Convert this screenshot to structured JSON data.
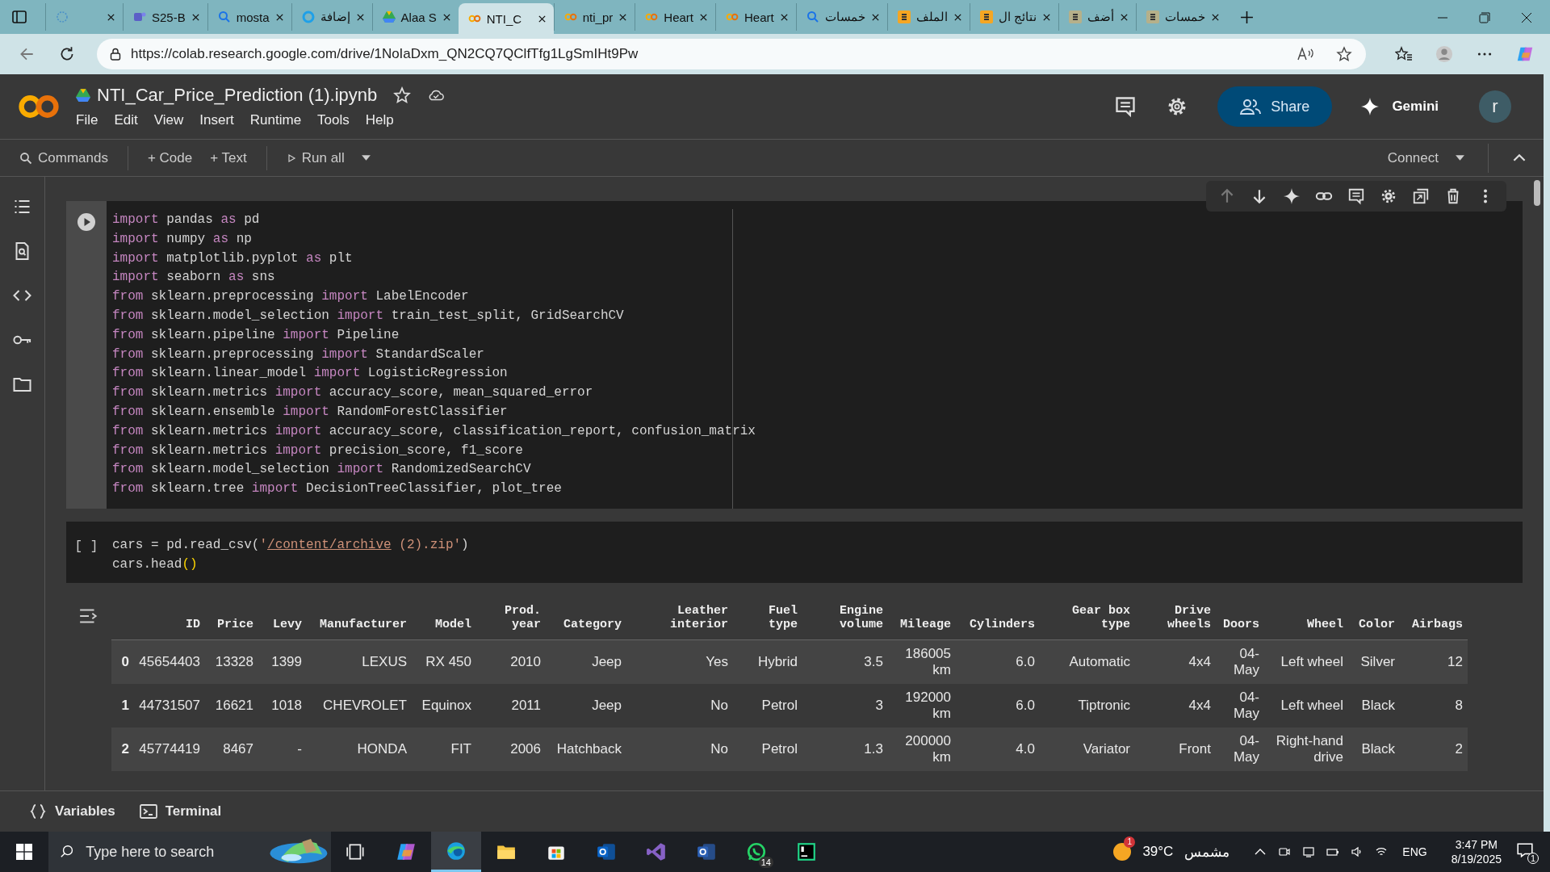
{
  "browser": {
    "tabs": [
      {
        "kind": "loading",
        "selected": false
      },
      {
        "label": "S25-B",
        "kind": "teams",
        "selected": false
      },
      {
        "label": "mosta",
        "kind": "search",
        "selected": false
      },
      {
        "label": "إضافة",
        "kind": "ring",
        "selected": false
      },
      {
        "label": "Alaa S",
        "kind": "drive",
        "selected": false
      },
      {
        "label": "NTI_C",
        "kind": "colab",
        "selected": true
      },
      {
        "label": "nti_pr",
        "kind": "colab",
        "selected": false
      },
      {
        "label": "Heart",
        "kind": "colab",
        "selected": false
      },
      {
        "label": "Heart",
        "kind": "colab",
        "selected": false
      },
      {
        "label": "خمسات",
        "kind": "search",
        "selected": false
      },
      {
        "label": "الملف",
        "kind": "five",
        "selected": false
      },
      {
        "label": "نتائج ال",
        "kind": "five",
        "selected": false
      },
      {
        "label": "أضف",
        "kind": "five-dim",
        "selected": false
      },
      {
        "label": "خمسات",
        "kind": "five-dim",
        "selected": false
      }
    ],
    "url": "https://colab.research.google.com/drive/1NoIaDxm_QN2CQ7QClfTfg1LgSmIHt9Pw"
  },
  "notebook": {
    "title": "NTI_Car_Price_Prediction (1).ipynb",
    "menu": [
      "File",
      "Edit",
      "View",
      "Insert",
      "Runtime",
      "Tools",
      "Help"
    ],
    "share": "Share",
    "gemini": "Gemini",
    "avatar": "r"
  },
  "toolbar": {
    "commands": "Commands",
    "add_code": "+ Code",
    "add_text": "+ Text",
    "run_all": "Run all",
    "connect": "Connect"
  },
  "cells": [
    {
      "kind": "run",
      "lines": [
        [
          {
            "kind": "keyword",
            "text": "import"
          },
          {
            "kind": "plain",
            "text": " pandas "
          },
          {
            "kind": "keyword",
            "text": "as"
          },
          {
            "kind": "plain",
            "text": " pd"
          }
        ],
        [
          {
            "kind": "keyword",
            "text": "import"
          },
          {
            "kind": "plain",
            "text": " numpy "
          },
          {
            "kind": "keyword",
            "text": "as"
          },
          {
            "kind": "plain",
            "text": " np"
          }
        ],
        [
          {
            "kind": "keyword",
            "text": "import"
          },
          {
            "kind": "plain",
            "text": " matplotlib.pyplot "
          },
          {
            "kind": "keyword",
            "text": "as"
          },
          {
            "kind": "plain",
            "text": " plt"
          }
        ],
        [
          {
            "kind": "keyword",
            "text": "import"
          },
          {
            "kind": "plain",
            "text": " seaborn "
          },
          {
            "kind": "keyword",
            "text": "as"
          },
          {
            "kind": "plain",
            "text": " sns"
          }
        ],
        [
          {
            "kind": "keyword",
            "text": "from"
          },
          {
            "kind": "plain",
            "text": " sklearn.preprocessing "
          },
          {
            "kind": "keyword",
            "text": "import"
          },
          {
            "kind": "plain",
            "text": " LabelEncoder"
          }
        ],
        [
          {
            "kind": "keyword",
            "text": "from"
          },
          {
            "kind": "plain",
            "text": " sklearn.model_selection "
          },
          {
            "kind": "keyword",
            "text": "import"
          },
          {
            "kind": "plain",
            "text": " train_test_split, GridSearchCV"
          }
        ],
        [
          {
            "kind": "keyword",
            "text": "from"
          },
          {
            "kind": "plain",
            "text": " sklearn.pipeline "
          },
          {
            "kind": "keyword",
            "text": "import"
          },
          {
            "kind": "plain",
            "text": " Pipeline"
          }
        ],
        [
          {
            "kind": "keyword",
            "text": "from"
          },
          {
            "kind": "plain",
            "text": " sklearn.preprocessing "
          },
          {
            "kind": "keyword",
            "text": "import"
          },
          {
            "kind": "plain",
            "text": " StandardScaler"
          }
        ],
        [
          {
            "kind": "keyword",
            "text": "from"
          },
          {
            "kind": "plain",
            "text": " sklearn.linear_model "
          },
          {
            "kind": "keyword",
            "text": "import"
          },
          {
            "kind": "plain",
            "text": " LogisticRegression"
          }
        ],
        [
          {
            "kind": "keyword",
            "text": "from"
          },
          {
            "kind": "plain",
            "text": " sklearn.metrics "
          },
          {
            "kind": "keyword",
            "text": "import"
          },
          {
            "kind": "plain",
            "text": " accuracy_score, mean_squared_error"
          }
        ],
        [
          {
            "kind": "keyword",
            "text": "from"
          },
          {
            "kind": "plain",
            "text": " sklearn.ensemble "
          },
          {
            "kind": "keyword",
            "text": "import"
          },
          {
            "kind": "plain",
            "text": " RandomForestClassifier"
          }
        ],
        [
          {
            "kind": "keyword",
            "text": "from"
          },
          {
            "kind": "plain",
            "text": " sklearn.metrics "
          },
          {
            "kind": "keyword",
            "text": "import"
          },
          {
            "kind": "plain",
            "text": " accuracy_score, classification_report, confusion_matrix"
          }
        ],
        [
          {
            "kind": "keyword",
            "text": "from"
          },
          {
            "kind": "plain",
            "text": " sklearn.metrics "
          },
          {
            "kind": "keyword",
            "text": "import"
          },
          {
            "kind": "plain",
            "text": " precision_score, f1_score"
          }
        ],
        [
          {
            "kind": "keyword",
            "text": "from"
          },
          {
            "kind": "plain",
            "text": " sklearn.model_selection "
          },
          {
            "kind": "keyword",
            "text": "import"
          },
          {
            "kind": "plain",
            "text": " RandomizedSearchCV"
          }
        ],
        [
          {
            "kind": "keyword",
            "text": "from"
          },
          {
            "kind": "plain",
            "text": " sklearn.tree "
          },
          {
            "kind": "keyword",
            "text": "import"
          },
          {
            "kind": "plain",
            "text": " DecisionTreeClassifier, plot_tree"
          }
        ]
      ]
    },
    {
      "kind": "idle",
      "prompt": "[ ]",
      "lines": [
        [
          {
            "kind": "plain",
            "text": "cars = pd.read_csv("
          },
          {
            "kind": "string",
            "text": "'"
          },
          {
            "kind": "link",
            "text": "/content/archive"
          },
          {
            "kind": "string",
            "text": " (2).zip'"
          },
          {
            "kind": "plain",
            "text": ")"
          }
        ],
        [
          {
            "kind": "plain",
            "text": "cars.head"
          },
          {
            "kind": "paren",
            "text": "()"
          }
        ]
      ]
    }
  ],
  "output": {
    "columns": [
      "ID",
      "Price",
      "Levy",
      "Manufacturer",
      "Model",
      "Prod. year",
      "Category",
      "Leather interior",
      "Fuel type",
      "Engine volume",
      "Mileage",
      "Cylinders",
      "Gear box type",
      "Drive wheels",
      "Doors",
      "Wheel",
      "Color",
      "Airbags"
    ],
    "rows": [
      {
        "index": "0",
        "cells": [
          "45654403",
          "13328",
          "1399",
          "LEXUS",
          "RX 450",
          "2010",
          "Jeep",
          "Yes",
          "Hybrid",
          "3.5",
          "186005 km",
          "6.0",
          "Automatic",
          "4x4",
          "04-May",
          "Left wheel",
          "Silver",
          "12"
        ]
      },
      {
        "index": "1",
        "cells": [
          "44731507",
          "16621",
          "1018",
          "CHEVROLET",
          "Equinox",
          "2011",
          "Jeep",
          "No",
          "Petrol",
          "3",
          "192000 km",
          "6.0",
          "Tiptronic",
          "4x4",
          "04-May",
          "Left wheel",
          "Black",
          "8"
        ]
      },
      {
        "index": "2",
        "cells": [
          "45774419",
          "8467",
          "-",
          "HONDA",
          "FIT",
          "2006",
          "Hatchback",
          "No",
          "Petrol",
          "1.3",
          "200000 km",
          "4.0",
          "Variator",
          "Front",
          "04-May",
          "Right-hand drive",
          "Black",
          "2"
        ]
      }
    ]
  },
  "bottom_bar": {
    "variables": "Variables",
    "terminal": "Terminal"
  },
  "taskbar": {
    "search_placeholder": "Type here to search",
    "apps": [
      {
        "kind": "taskview",
        "active": false
      },
      {
        "kind": "copilot",
        "active": false
      },
      {
        "kind": "edge",
        "active": true
      },
      {
        "kind": "folder",
        "active": false
      },
      {
        "kind": "store",
        "active": false
      },
      {
        "kind": "outlook",
        "active": false
      },
      {
        "kind": "vs",
        "active": false
      },
      {
        "kind": "word",
        "active": false
      },
      {
        "kind": "whatsapp",
        "active": false,
        "badge": "14"
      },
      {
        "kind": "pycharm",
        "active": false
      }
    ],
    "weather_badge": "1",
    "temperature": "39°C",
    "condition": "مشمس",
    "language": "ENG",
    "time": "3:47 PM",
    "date": "8/19/2025",
    "notifications": "1"
  }
}
